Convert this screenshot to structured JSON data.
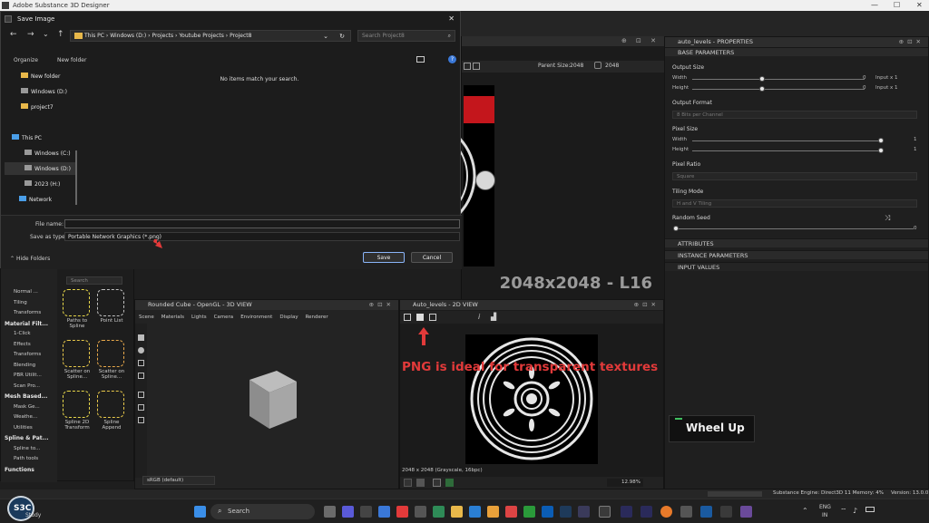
{
  "window": {
    "title": "Adobe Substance 3D Designer"
  },
  "dialog": {
    "title": "Save Image",
    "address": [
      "This PC",
      "Windows (D:)",
      "Projects",
      "Youtube Projects",
      "Project8"
    ],
    "search_placeholder": "Search Project8",
    "toolbar": {
      "organize": "Organize",
      "new_folder": "New folder"
    },
    "empty_message": "No items match your search.",
    "nav_items": [
      "New folder",
      "Windows (D:)",
      "project7",
      "This PC",
      "Windows (C:)",
      "Windows (D:)",
      "2023 (H:)",
      "Network"
    ],
    "file_name_label": "File name:",
    "file_name_value": "",
    "save_type_label": "Save as type:",
    "save_type_value": "Portable Network Graphics (*.png)",
    "save_label": "Save",
    "cancel_label": "Cancel",
    "hide_folders": "Hide Folders"
  },
  "view2d_top": {
    "parent_size_label": "Parent Size:",
    "parent_size_value": "2048",
    "size_value": "2048",
    "resolution_overlay": "2048x2048 - L16"
  },
  "properties": {
    "header": "auto_levels - PROPERTIES",
    "base_parameters": "BASE PARAMETERS",
    "output_size": {
      "label": "Output Size",
      "width": "Width",
      "height": "Height",
      "w_val": "0",
      "h_val": "0",
      "w_rel": "Input x 1",
      "h_rel": "Input x 1"
    },
    "output_format": {
      "label": "Output Format",
      "value": "8 Bits per Channel"
    },
    "pixel_size": {
      "label": "Pixel Size",
      "width": "Width",
      "height": "Height",
      "w_val": "1",
      "h_val": "1"
    },
    "pixel_ratio": {
      "label": "Pixel Ratio",
      "value": "Square"
    },
    "tiling_mode": {
      "label": "Tiling Mode",
      "value": "H and V Tiling"
    },
    "random_seed": {
      "label": "Random Seed",
      "value": "0"
    },
    "attributes": "ATTRIBUTES",
    "instance_parameters": "INSTANCE PARAMETERS",
    "input_values": "INPUT VALUES"
  },
  "library": {
    "search_placeholder": "Search",
    "categories": [
      {
        "label": "Normal ...",
        "type": "item"
      },
      {
        "label": "Tiling",
        "type": "item"
      },
      {
        "label": "Transforms",
        "type": "item"
      },
      {
        "label": "Material Filt...",
        "type": "cat"
      },
      {
        "label": "1-Click",
        "type": "item"
      },
      {
        "label": "Effects",
        "type": "item"
      },
      {
        "label": "Transforms",
        "type": "item"
      },
      {
        "label": "Blending",
        "type": "item"
      },
      {
        "label": "PBR Utilit...",
        "type": "item"
      },
      {
        "label": "Scan Pro...",
        "type": "item"
      },
      {
        "label": "Mesh Based...",
        "type": "cat"
      },
      {
        "label": "Mask Ge...",
        "type": "item"
      },
      {
        "label": "Weathe...",
        "type": "item"
      },
      {
        "label": "Utilities",
        "type": "item"
      },
      {
        "label": "Spline & Pat...",
        "type": "cat"
      },
      {
        "label": "Spline to...",
        "type": "item"
      },
      {
        "label": "Path tools",
        "type": "item"
      },
      {
        "label": "Functions",
        "type": "cat"
      }
    ],
    "thumbs": [
      "Paths to Spline",
      "Point List",
      "Scatter on Spline...",
      "Scatter on Spline...",
      "Spline 2D Transform",
      "Spline Append"
    ]
  },
  "view3d": {
    "header": "Rounded Cube - OpenGL - 3D VIEW",
    "menu": [
      "Scene",
      "Materials",
      "Lights",
      "Camera",
      "Environment",
      "Display",
      "Renderer"
    ],
    "colorspace": "sRGB (default)"
  },
  "view2d": {
    "header": "Auto_levels - 2D VIEW",
    "annotation": "PNG is ideal for transparent textures",
    "status": "2048 x 2048 (Grayscale, 16bpc)",
    "zoom": "12.98%"
  },
  "overlay_key": "Wheel Up",
  "status_bar": {
    "engine": "Substance Engine: Direct3D 11  Memory: 4%",
    "version": "Version: 13.0.0"
  },
  "taskbar": {
    "search": "Search",
    "lang": "ENG",
    "region": "IN",
    "study": "Study"
  },
  "colors": {
    "accent_red": "#e23a3a",
    "highlight_red": "#c4161c",
    "key_green": "#3fbf5f"
  }
}
